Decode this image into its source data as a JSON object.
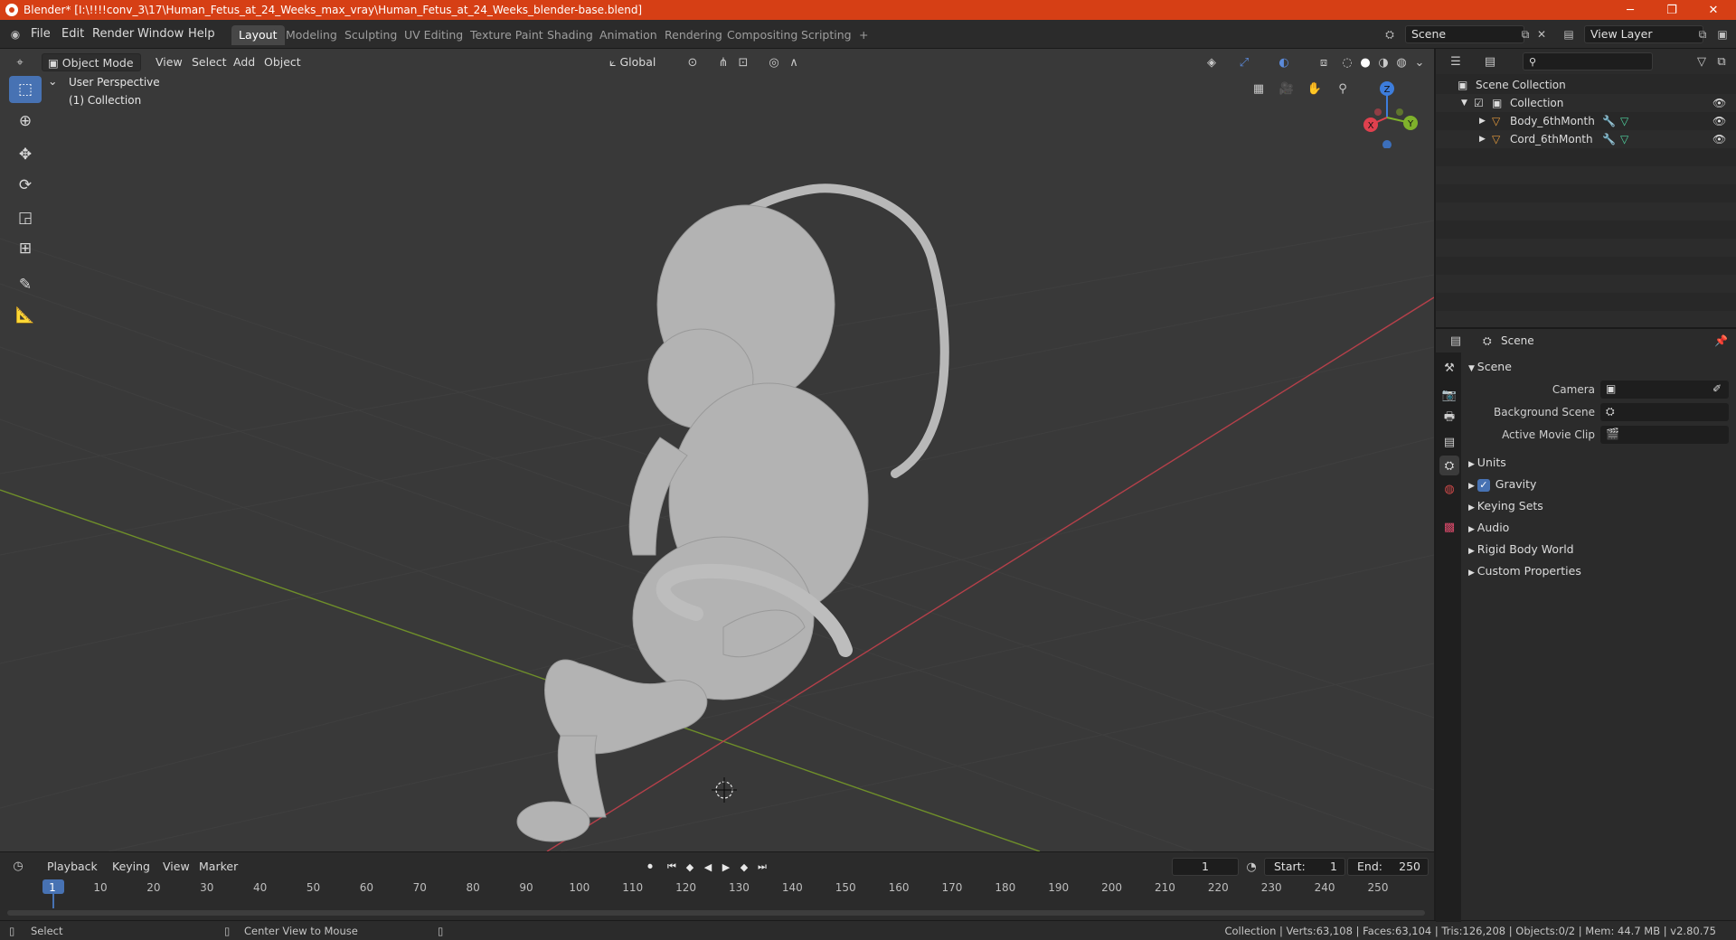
{
  "title_bar": {
    "title": "Blender* [I:\\!!!!conv_3\\17\\Human_Fetus_at_24_Weeks_max_vray\\Human_Fetus_at_24_Weeks_blender-base.blend]",
    "minimize": "─",
    "maximize": "❐",
    "close": "✕"
  },
  "menu": [
    "File",
    "Edit",
    "Render",
    "Window",
    "Help"
  ],
  "workspaces": [
    "Layout",
    "Modeling",
    "Sculpting",
    "UV Editing",
    "Texture Paint",
    "Shading",
    "Animation",
    "Rendering",
    "Compositing",
    "Scripting"
  ],
  "workspace_add": "+",
  "scene_field": "Scene",
  "view_layer_field": "View Layer",
  "viewport": {
    "mode": "Object Mode",
    "menus": [
      "View",
      "Select",
      "Add",
      "Object"
    ],
    "orientation": "Global",
    "perspective_label": "User Perspective",
    "collection_label": "(1) Collection",
    "gizmo_axes": {
      "x": "X",
      "y": "Y",
      "z": "Z"
    }
  },
  "outliner": {
    "search_placeholder": "",
    "root": "Scene Collection",
    "collection": "Collection",
    "objects": [
      "Body_6thMonth",
      "Cord_6thMonth"
    ]
  },
  "properties": {
    "context_name": "Scene",
    "section": "Scene",
    "fields": [
      "Camera",
      "Background Scene",
      "Active Movie Clip"
    ],
    "panels": [
      "Units",
      "Gravity",
      "Keying Sets",
      "Audio",
      "Rigid Body World",
      "Custom Properties"
    ],
    "gravity_checked": true
  },
  "timeline": {
    "menus": [
      "Playback",
      "Keying",
      "View",
      "Marker"
    ],
    "current_frame": "1",
    "start_label": "Start:",
    "start_value": "1",
    "end_label": "End:",
    "end_value": "250",
    "frame_ticks": [
      "1",
      "10",
      "20",
      "30",
      "40",
      "50",
      "60",
      "70",
      "80",
      "90",
      "100",
      "110",
      "120",
      "130",
      "140",
      "150",
      "160",
      "170",
      "180",
      "190",
      "200",
      "210",
      "220",
      "230",
      "240",
      "250"
    ]
  },
  "status_bar": {
    "left_hint": "Select",
    "middle_hint": "Center View to Mouse",
    "stats": "Collection | Verts:63,108 | Faces:63,104 | Tris:126,208 | Objects:0/2 | Mem: 44.7 MB | v2.80.75"
  },
  "colors": {
    "title_bar": "#d63f15",
    "accent_blue": "#4772b3",
    "x_axis": "#e0404e",
    "y_axis": "#7fb22b",
    "z_axis": "#3d7ddc",
    "object_orange": "#e59a3c"
  }
}
